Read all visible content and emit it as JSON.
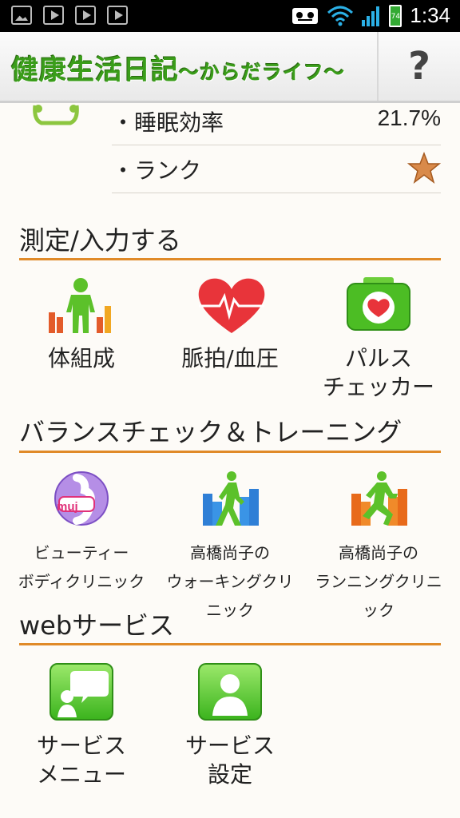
{
  "status_bar": {
    "time": "1:34",
    "battery": "74"
  },
  "header": {
    "title": "健康生活日記",
    "subtitle": "〜からだライフ〜",
    "help": "?"
  },
  "stats": [
    {
      "label": "・睡眠効率",
      "value": "21.7%"
    },
    {
      "label": "・ランク",
      "value": ""
    }
  ],
  "sections": {
    "measure": {
      "title": "測定/入力する",
      "tiles": [
        "体組成",
        "脈拍/血圧",
        "パルス\nチェッカー"
      ]
    },
    "balance": {
      "title": "バランスチェック＆トレーニング",
      "tiles": [
        "ビューティー\nボディクリニック",
        "高橋尚子の\nウォーキングクリニック",
        "高橋尚子の\nランニングクリニック"
      ],
      "badge": "muj"
    },
    "web": {
      "title": "webサービス",
      "tiles": [
        "サービス\nメニュー",
        "サービス\n設定"
      ]
    }
  },
  "colors": {
    "accent": "#e08a28",
    "brand_green": "#3a9d1a"
  }
}
